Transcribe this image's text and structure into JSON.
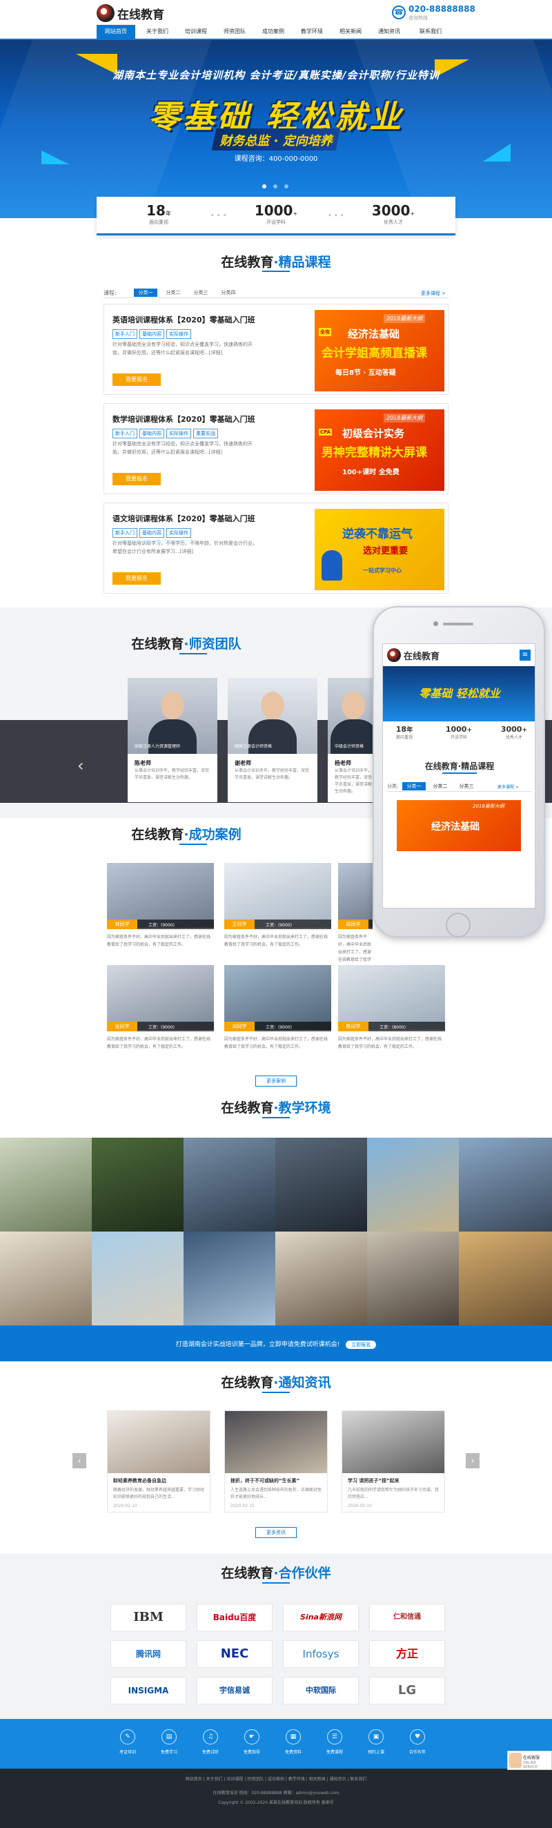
{
  "header": {
    "logo_text": "在线教育",
    "phone": "020-88888888",
    "phone_sub": "咨询热线"
  },
  "nav": [
    "网站首页",
    "关于我们",
    "培训课程",
    "师资团队",
    "成功案例",
    "教学环境",
    "相关新闻",
    "通知资讯",
    "联系我们"
  ],
  "banner": {
    "top_line": "湖南本土专业会计培训机构  会计考证/真账实操/会计职称/行业特训",
    "main": "零基础 轻松就业",
    "sub": "财务总监 · 定向培养",
    "tel": "课程咨询：400-000-0000"
  },
  "stats": [
    {
      "num": "18",
      "unit": "年",
      "label": "面向重视"
    },
    {
      "num": "1000",
      "unit": "+",
      "label": "开设学科"
    },
    {
      "num": "3000",
      "unit": "+",
      "label": "优秀人才"
    }
  ],
  "courses_section": {
    "title_a": "在线教育",
    "title_b": "·精品课程",
    "tab_label": "课程:",
    "tabs": [
      "分类一",
      "分类二",
      "分类三",
      "分类四"
    ],
    "more": "更多课程 >",
    "items": [
      {
        "title": "英语培训课程体系【2020】零基础入门班",
        "tags": [
          "新手入门",
          "基础内容",
          "实际操作"
        ],
        "desc": "针对零基础完全没有学习经验，知识点全覆盖学习，快速熟练的开始，并做好应用，还等什么赶紧报名课程吧...[详细]",
        "button": "我要报名",
        "img_tag": "2018最新大纲",
        "img_badge": "全攻",
        "img_l1": "经济法基础",
        "img_l2": "会计学姐高频直播课",
        "img_l3": "每日8节 · 互动答疑"
      },
      {
        "title": "数学培训课程体系【2020】零基础入门班",
        "tags": [
          "新手入门",
          "基础内容",
          "实际操作",
          "重要实战"
        ],
        "desc": "针对零基础完全没有学习经验，知识点全覆盖学习，快速熟练的开始，并做好应用，还等什么赶紧报名课程吧...[详细]",
        "button": "我要报名",
        "img_tag": "2018最新大纲",
        "img_badge": "CPA",
        "img_l1": "初级会计实务",
        "img_l2": "男神完整精讲大屏课",
        "img_l3": "100+课时 全免费"
      },
      {
        "title": "语文培训课程体系【2020】零基础入门班",
        "tags": [
          "新手入门",
          "基础内容",
          "实际操作"
        ],
        "desc": "针对零基础培训班学习，不限学历，不限年龄，针对热爱会计行业，希望在会计行业有所发展学习...[详细]",
        "button": "我要报名",
        "img_tag": "",
        "img_badge": "",
        "img_l1": "逆袭不靠运气",
        "img_l2": "选对更重要",
        "img_l3": "一站式学习中心"
      }
    ]
  },
  "teachers_section": {
    "title_a": "在线教育",
    "title_b": "·师资团队",
    "items": [
      {
        "name": "陈老师",
        "caption": "国家注册人力资源管理师",
        "desc": "从事会计培训多年，教学经验丰富，深受学员喜爱，课堂讲解生动有趣。"
      },
      {
        "name": "谢老师",
        "caption": "国家注册会计师资格",
        "desc": "从事会计培训多年，教学经验丰富，深受学员喜爱，课堂讲解生动有趣。"
      },
      {
        "name": "杨老师",
        "caption": "中级会计师资格",
        "desc": "从事会计培训多年，教学经验丰富，深受学员喜爱，课堂讲解生动有趣。"
      }
    ]
  },
  "cases_section": {
    "title_a": "在线教育",
    "title_b": "·成功案例",
    "items": [
      {
        "name": "林同学",
        "pay": "工资：(9000)",
        "desc": "因为家庭条件不好，高中毕业后就出来打工了，感谢在线教育给了我学习的机会，有了稳定的工作。"
      },
      {
        "name": "王同学",
        "pay": "工资：(9000)",
        "desc": "因为家庭条件不好，高中毕业后就出来打工了，感谢在线教育给了我学习的机会，有了稳定的工作。"
      },
      {
        "name": "周同学",
        "pay": "工资：(9000)",
        "desc": "因为家庭条件不好，高中毕业后就出来打工了，感谢在线教育给了我学习的机会，有了稳定的工作。"
      },
      {
        "name": "张同学",
        "pay": "工资：(9000)",
        "desc": "因为家庭条件不好，高中毕业后就出来打工了，感谢在线教育给了我学习的机会，有了稳定的工作。"
      },
      {
        "name": "刘同学",
        "pay": "工资：(9000)",
        "desc": "因为家庭条件不好，高中毕业后就出来打工了，感谢在线教育给了我学习的机会，有了稳定的工作。"
      },
      {
        "name": "陈同学",
        "pay": "工资：(8000)",
        "desc": "因为家庭条件不好，高中毕业后就出来打工了，感谢在线教育给了我学习的机会，有了稳定的工作。"
      }
    ],
    "more": "更多案例"
  },
  "env_section": {
    "title_a": "在线教育",
    "title_b": "·教学环境",
    "strip": "打造湖南会计实战培训第一品牌，立即申请免费试听课机会!",
    "strip_btn": "立即报名"
  },
  "news_section": {
    "title_a": "在线教育",
    "title_b": "·通知资讯",
    "items": [
      {
        "title": "财经素养教育必备自急边",
        "desc": "随着经济的发展，财经素养越来越重要，学习财经知识能够更好的规划自己的生活...",
        "date": "2020-02-10"
      },
      {
        "title": "挫折，终于不可或缺的“生长素”",
        "desc": "人生道路上总会遇到各种各样的挫折，正确面对挫折才能更好地成长...",
        "date": "2020-02-10"
      },
      {
        "title": "学习 请把孩子“捏”起来",
        "desc": "几天前我的同学请我帮忙为她的孩子补习功课，我欣然答应...",
        "date": "2020-02-10"
      }
    ],
    "more": "更多资讯"
  },
  "partners_section": {
    "title_a": "在线教育",
    "title_b": "·合作伙伴",
    "items": [
      "IBM",
      "Baidu百度",
      "Sina新浪网",
      "仁和信通",
      "腾讯网",
      "NEC",
      "Infosys",
      "方正",
      "INSIGMA",
      "宇信易诚",
      "中软国际",
      "LG"
    ]
  },
  "footer": {
    "items": [
      "考证培训",
      "免费学习",
      "免费试听",
      "免费指导",
      "免费资料",
      "免费课程",
      "预约上课",
      "合作伙伴"
    ],
    "links": "网站首页 | 关于我们 | 培训课程 | 师资团队 | 成功案例 | 教学环境 | 相关新闻 | 通知资讯 | 联系我们",
    "line1": "在线教育培训 热线：020-88888888  邮箱：admin@youweb.com",
    "line2": "Copyright © 2002-2020 某某在线教育培训 版权所有  备案号"
  },
  "phone_mock": {
    "logo": "在线教育",
    "banner_main": "零基础 轻松就业",
    "stats": [
      {
        "num": "18",
        "unit": "年",
        "label": "面向重视"
      },
      {
        "num": "1000",
        "unit": "+",
        "label": "开设学科"
      },
      {
        "num": "3000",
        "unit": "+",
        "label": "优秀人才"
      }
    ],
    "section": "在线教育·精品课程",
    "tab_label": "分类:",
    "tabs": [
      "分类一",
      "分类二",
      "分类三"
    ],
    "more": "更多课程 >",
    "course_tag": "2018最新大纲",
    "course_text": "经济法基础"
  },
  "chat": {
    "title": "在线客服",
    "sub": "ONLINE SERVICE"
  }
}
